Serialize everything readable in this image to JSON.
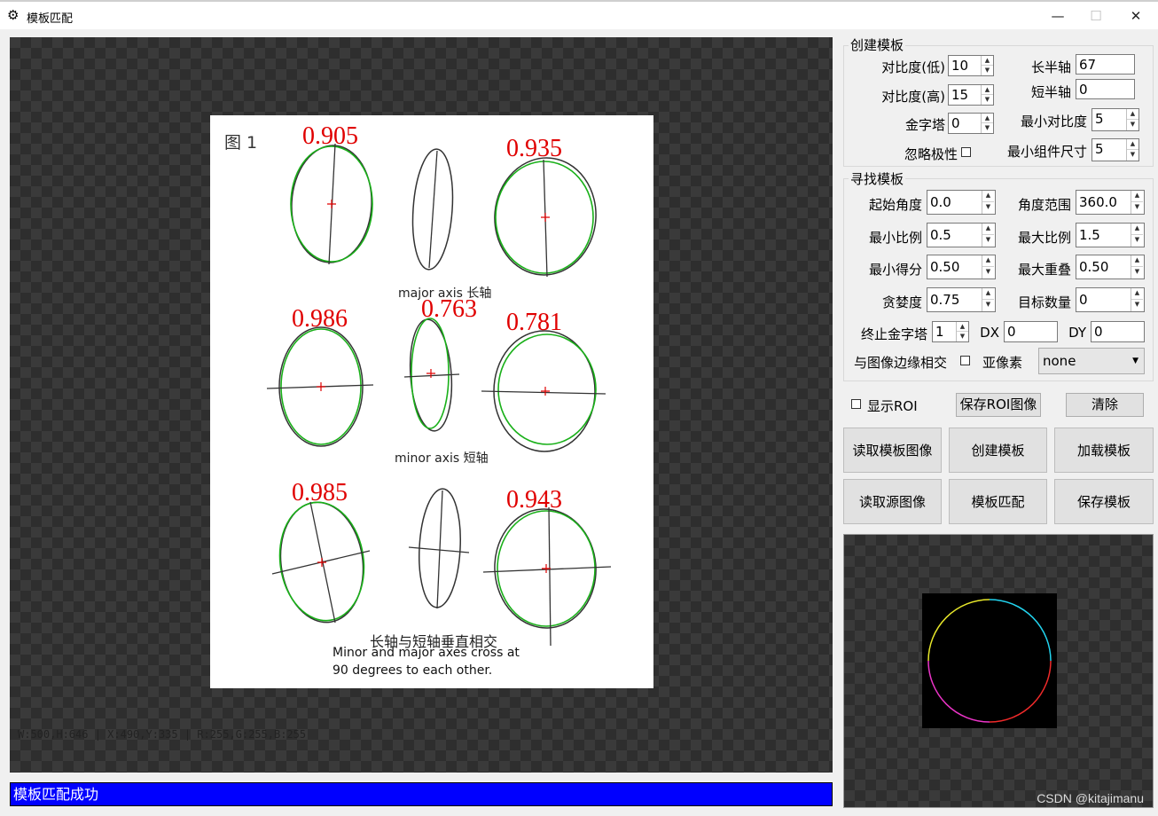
{
  "window": {
    "title": "模板匹配",
    "minimize": "—",
    "maximize": "☐",
    "close": "✕"
  },
  "canvas": {
    "info_text": "W:500,H:646 | X:490,Y:335 | R:255,G:255,B:255",
    "figure": {
      "label": "图 1",
      "scores": [
        "0.905",
        "0.935",
        "0.986",
        "0.763",
        "0.781",
        "0.985",
        "0.943"
      ],
      "caption_major": "major axis 长轴",
      "caption_minor": "minor axis  短轴",
      "caption_cross_cn": "长轴与短轴垂直相交",
      "caption_cross_en_1": "Minor and major axes cross at",
      "caption_cross_en_2": "90 degrees to each other."
    }
  },
  "create_template": {
    "title": "创建模板",
    "contrast_low_label": "对比度(低)",
    "contrast_low": "10",
    "contrast_high_label": "对比度(高)",
    "contrast_high": "15",
    "pyramid_label": "金字塔",
    "pyramid": "0",
    "ignore_polarity_label": "忽略极性",
    "major_axis_label": "长半轴",
    "major_axis": "67",
    "minor_axis_label": "短半轴",
    "minor_axis": "0",
    "min_contrast_label": "最小对比度",
    "min_contrast": "5",
    "min_component_label": "最小组件尺寸",
    "min_component": "5"
  },
  "find_template": {
    "title": "寻找模板",
    "start_angle_label": "起始角度",
    "start_angle": "0.0",
    "angle_range_label": "角度范围",
    "angle_range": "360.0",
    "min_scale_label": "最小比例",
    "min_scale": "0.5",
    "max_scale_label": "最大比例",
    "max_scale": "1.5",
    "min_score_label": "最小得分",
    "min_score": "0.50",
    "max_overlap_label": "最大重叠",
    "max_overlap": "0.50",
    "greediness_label": "贪婪度",
    "greediness": "0.75",
    "num_targets_label": "目标数量",
    "num_targets": "0",
    "stop_pyramid_label": "终止金字塔",
    "stop_pyramid": "1",
    "dx_label": "DX",
    "dx": "0",
    "dy_label": "DY",
    "dy": "0",
    "intersect_edge_label": "与图像边缘相交",
    "subpixel_label": "亚像素",
    "subpixel": "none"
  },
  "actions": {
    "show_roi_label": "显示ROI",
    "save_roi": "保存ROI图像",
    "clear": "清除",
    "read_template_image": "读取模板图像",
    "create_template": "创建模板",
    "load_template": "加载模板",
    "read_source_image": "读取源图像",
    "template_match": "模板匹配",
    "save_template": "保存模板"
  },
  "status_text": "模板匹配成功",
  "watermark": "CSDN @kitajimanu",
  "colors": {
    "status_bg": "#0000ff",
    "score_red": "#e00000",
    "match_green": "#19b019"
  }
}
